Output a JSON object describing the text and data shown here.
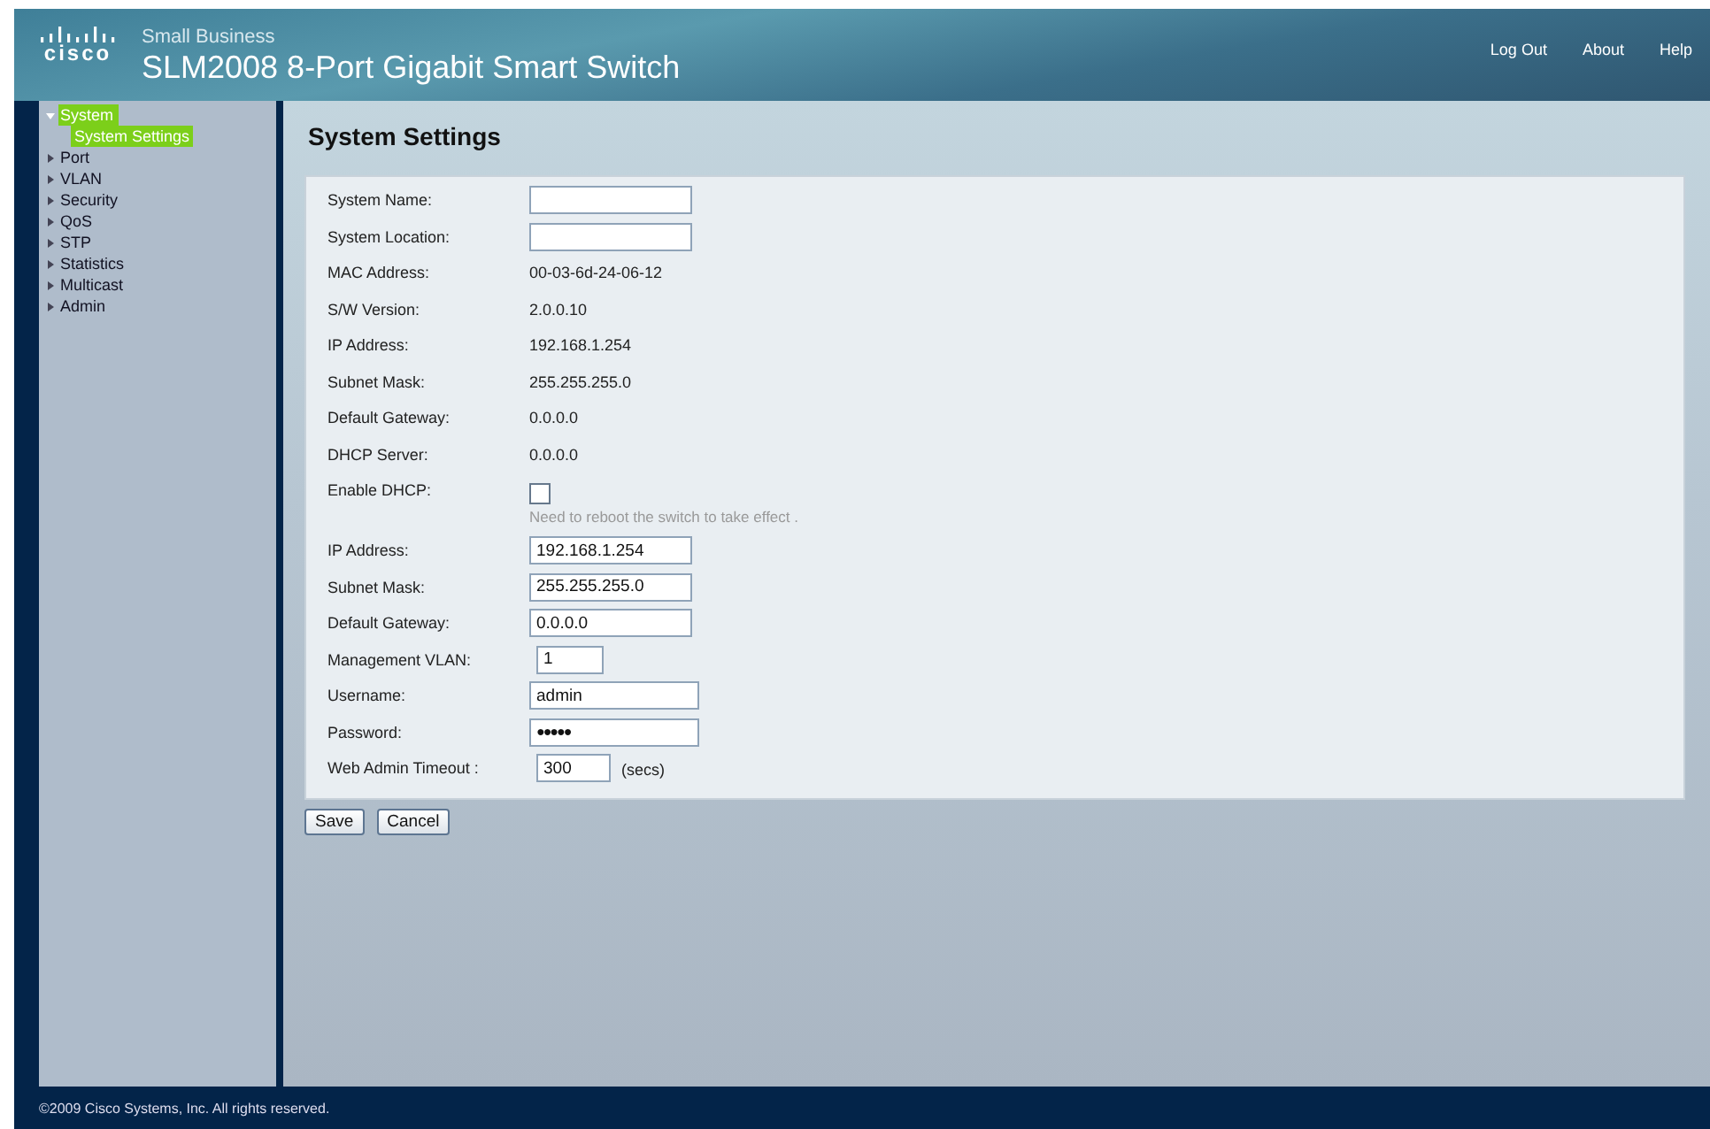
{
  "header": {
    "logo_text": "cisco",
    "brand": "Small Business",
    "title": "SLM2008 8-Port Gigabit Smart Switch",
    "links": [
      "Log Out",
      "About",
      "Help"
    ]
  },
  "sidebar": {
    "items": [
      {
        "label": "System",
        "expanded": true,
        "selected": true,
        "children": [
          {
            "label": "System Settings",
            "selected": true
          }
        ]
      },
      {
        "label": "Port",
        "expanded": false,
        "selected": false
      },
      {
        "label": "VLAN",
        "expanded": false,
        "selected": false
      },
      {
        "label": "Security",
        "expanded": false,
        "selected": false
      },
      {
        "label": "QoS",
        "expanded": false,
        "selected": false
      },
      {
        "label": "STP",
        "expanded": false,
        "selected": false
      },
      {
        "label": "Statistics",
        "expanded": false,
        "selected": false
      },
      {
        "label": "Multicast",
        "expanded": false,
        "selected": false
      },
      {
        "label": "Admin",
        "expanded": false,
        "selected": false
      }
    ]
  },
  "page_title": "System Settings",
  "fields": [
    {
      "kind": "input",
      "label": "System Name:"
    },
    {
      "kind": "input",
      "label": "System Location:"
    },
    {
      "kind": "text",
      "label": "MAC Address:",
      "value": "00-03-6d-24-06-12"
    },
    {
      "kind": "text",
      "label": "S/W Version:",
      "value": "2.0.0.10"
    },
    {
      "kind": "text",
      "label": "IP Address:",
      "value": "192.168.1.254"
    },
    {
      "kind": "text",
      "label": "Subnet Mask:",
      "value": "255.255.255.0"
    },
    {
      "kind": "text",
      "label": "Default Gateway:",
      "value": "0.0.0.0"
    },
    {
      "kind": "text",
      "label": "DHCP Server:",
      "value": "0.0.0.0"
    },
    {
      "kind": "checkbox",
      "label": "Enable DHCP:",
      "checked": false,
      "note": "Need to reboot the switch to take effect ."
    },
    {
      "kind": "input",
      "label": "IP Address:",
      "value": "192.168.1.254"
    },
    {
      "kind": "input",
      "label": "Subnet Mask:",
      "value": "255.255.255.0"
    },
    {
      "kind": "input",
      "label": "Default Gateway:",
      "value": "0.0.0.0"
    },
    {
      "kind": "input",
      "label": "Management VLAN:",
      "value": "1"
    },
    {
      "kind": "input",
      "label": "Username:",
      "value": "admin"
    },
    {
      "kind": "password",
      "label": "Password:",
      "value": "●●●●●"
    },
    {
      "kind": "input",
      "label": "Web Admin Timeout :",
      "value": "300",
      "unit": "(secs)"
    }
  ],
  "buttons": [
    "Save",
    "Cancel"
  ],
  "footer": "©2009 Cisco Systems, Inc. All rights reserved."
}
